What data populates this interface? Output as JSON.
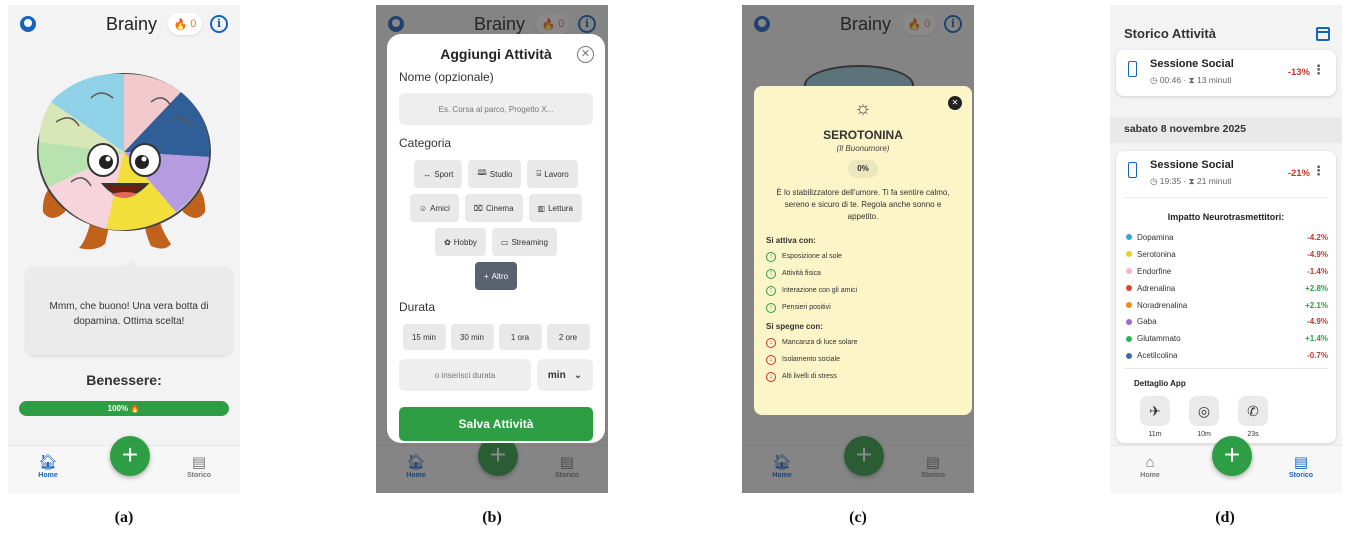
{
  "captions": [
    "(a)",
    "(b)",
    "(c)",
    "(d)"
  ],
  "app_title": "Brainy",
  "streak_count": "0",
  "nav": {
    "home": "Home",
    "history": "Storico"
  },
  "colors": {
    "accent_green": "#2e9e44",
    "accent_blue": "#1565c0",
    "negative_red": "#c0392b",
    "serotonin_card": "#fcf5c7"
  },
  "screen_a": {
    "message": "Mmm, che buono! Una vera botta di dopamina. Ottima scelta!",
    "wellbeing_label": "Benessere:",
    "wellbeing_value": "100%",
    "wellbeing_level": 1.0
  },
  "screen_b": {
    "title": "Aggiungi Attività",
    "name_label": "Nome (opzionale)",
    "name_placeholder": "Es. Corsa al parco, Progetto X...",
    "category_label": "Categoria",
    "categories": [
      {
        "icon": "↔",
        "label": "Sport"
      },
      {
        "icon": "🕮",
        "label": "Studio"
      },
      {
        "icon": "⌸",
        "label": "Lavoro"
      },
      {
        "icon": "☺",
        "label": "Amici"
      },
      {
        "icon": "⌧",
        "label": "Cinema"
      },
      {
        "icon": "▥",
        "label": "Lettura"
      },
      {
        "icon": "✿",
        "label": "Hobby"
      },
      {
        "icon": "▭",
        "label": "Streaming"
      },
      {
        "icon": "+",
        "label": "Altro"
      }
    ],
    "duration_label": "Durata",
    "durations": [
      "15 min",
      "30 min",
      "1 ora",
      "2 ore"
    ],
    "custom_duration_placeholder": "o inserisci durata",
    "unit": "min",
    "save_label": "Salva Attività"
  },
  "screen_c": {
    "name": "SEROTONINA",
    "subtitle": "(Il Buonumore)",
    "percent": "0%",
    "description": "È lo stabilizzatore dell'umore. Ti fa sentire calmo, sereno e sicuro di te. Regola anche sonno e appetito.",
    "activates_label": "Si attiva con:",
    "activates": [
      "Esposizione al sole",
      "Attività fisica",
      "Interazione con gli amici",
      "Pensieri positivi"
    ],
    "deactivates_label": "Si spegne con:",
    "deactivates": [
      "Mancanza di luce solare",
      "Isolamento sociale",
      "Alti livelli di stress"
    ]
  },
  "screen_d": {
    "title": "Storico Attività",
    "session1": {
      "name": "Sessione Social",
      "time": "00:46",
      "duration": "13 minuti",
      "impact": "-13%"
    },
    "date_header": "sabato 8 novembre 2025",
    "session2": {
      "name": "Sessione Social",
      "time": "19:35",
      "duration": "21 minuti",
      "impact": "-21%"
    },
    "impact_title": "Impatto Neurotrasmettitori:",
    "neurotransmitters": [
      {
        "name": "Dopamina",
        "value": "-4.2%",
        "color": "#2eaadc"
      },
      {
        "name": "Serotonina",
        "value": "-4.9%",
        "color": "#e8d024"
      },
      {
        "name": "Endorfine",
        "value": "-1.4%",
        "color": "#f4b6c8"
      },
      {
        "name": "Adrenalina",
        "value": "+2.8%",
        "color": "#e0442b"
      },
      {
        "name": "Noradrenalina",
        "value": "+2.1%",
        "color": "#f08c1e"
      },
      {
        "name": "Gaba",
        "value": "-4.9%",
        "color": "#9b6bd6"
      },
      {
        "name": "Glutammato",
        "value": "+1.4%",
        "color": "#2eb84d"
      },
      {
        "name": "Acetilcolina",
        "value": "-0.7%",
        "color": "#3a6ea8"
      }
    ],
    "app_detail_label": "Dettaglio App",
    "apps": [
      {
        "icon": "telegram-icon",
        "time": "11m"
      },
      {
        "icon": "instagram-icon",
        "time": "10m"
      },
      {
        "icon": "whatsapp-icon",
        "time": "23s"
      }
    ]
  }
}
